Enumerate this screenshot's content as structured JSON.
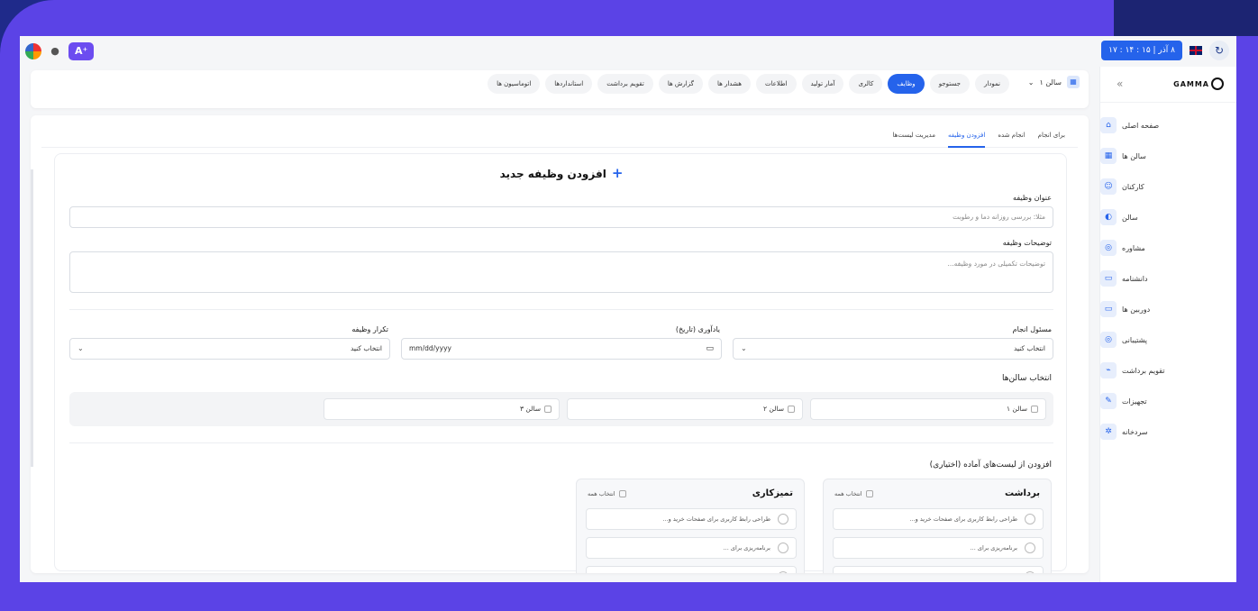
{
  "topbar": {
    "ai_label": "A⁺",
    "clock": "۸ آذر | ۱۵ : ۱۴ : ۱۷",
    "refresh_icon": "refresh-icon"
  },
  "sidebar": {
    "brand": "GAMMA",
    "collapse": "«",
    "items": [
      {
        "label": "صفحه اصلی",
        "icon": "⌂"
      },
      {
        "label": "سالن ها",
        "icon": "▦"
      },
      {
        "label": "کارکنان",
        "icon": "☺"
      },
      {
        "label": "سالن",
        "icon": "◐"
      },
      {
        "label": "مشاوره",
        "icon": "◎"
      },
      {
        "label": "دانشنامه",
        "icon": "▭"
      },
      {
        "label": "دوربین ها",
        "icon": "▭"
      },
      {
        "label": "پشتیبانی",
        "icon": "◎"
      },
      {
        "label": "تقویم برداشت",
        "icon": "⌁"
      },
      {
        "label": "تجهیزات",
        "icon": "✎"
      },
      {
        "label": "سردخانه",
        "icon": "✲"
      }
    ]
  },
  "navbar": {
    "salon_select": "سالن ۱",
    "tabs": [
      "نمودار",
      "جستوجو",
      "وظایف",
      "کالری",
      "آمار تولید",
      "اطلاعات",
      "هشدار ها",
      "گزارش ها",
      "تقویم برداشت",
      "استاندارد‌ها",
      "اتوماسیون ها"
    ],
    "active_tab": "وظایف"
  },
  "subtabs": [
    "برای انجام",
    "انجام شده",
    "افزودن وظیفه",
    "مدیریت لیست‌ها"
  ],
  "form": {
    "title": "افزودن وظیفه جدید",
    "task_title_label": "عنوان وظیفه",
    "task_title_placeholder": "مثلا: بررسی روزانه دما و رطوبت",
    "desc_label": "توضیحات وظیفه",
    "desc_placeholder": "توضیحات تکمیلی در مورد وظیفه...",
    "responsible_label": "مسئول انجام",
    "responsible_value": "انتخاب کنید",
    "reminder_label": "یادآوری (تاریخ)",
    "reminder_value": "mm/dd/yyyy",
    "repeat_label": "تکرار وظیفه",
    "repeat_value": "انتخاب کنید",
    "salons_label": "انتخاب سالن‌ها",
    "salons": [
      "سالن ۱",
      "سالن ۲",
      "سالن ۳"
    ],
    "ready_lists_label": "افزودن از لیست‌های آماده (اختیاری)"
  },
  "lists": [
    {
      "title": "برداشت",
      "select_all": "انتخاب همه",
      "items": [
        "طراحی رابط کاربری برای صفحات خرید و...",
        "برنامه‌ریزی برای ..."
      ]
    },
    {
      "title": "تمیزکاری",
      "select_all": "انتخاب همه",
      "items": [
        "طراحی رابط کاربری برای صفحات خرید و...",
        "برنامه‌ریزی برای ..."
      ]
    }
  ]
}
